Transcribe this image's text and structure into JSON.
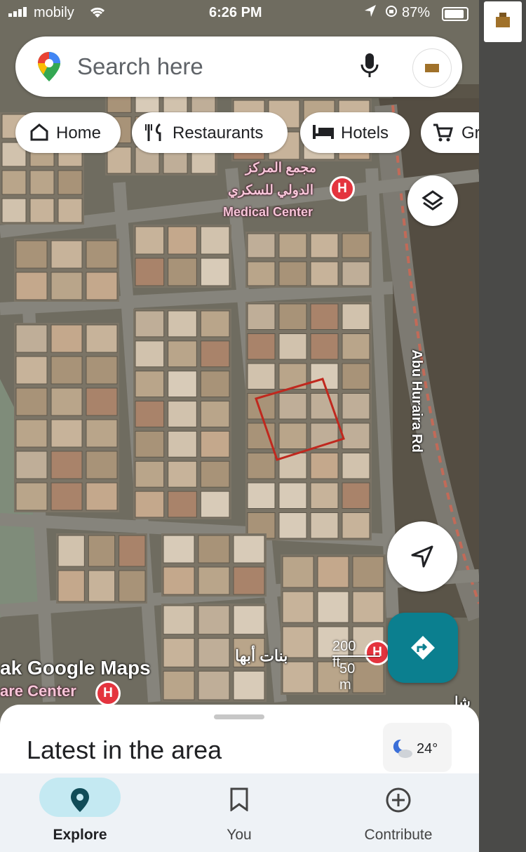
{
  "status": {
    "carrier": "mobily",
    "time": "6:26 PM",
    "battery": "87%"
  },
  "search": {
    "placeholder": "Search here"
  },
  "chips": [
    {
      "label": "Home",
      "icon": "home-icon"
    },
    {
      "label": "Restaurants",
      "icon": "restaurant-icon"
    },
    {
      "label": "Hotels",
      "icon": "hotel-icon"
    },
    {
      "label": "Gr",
      "icon": "cart-icon"
    }
  ],
  "map": {
    "labels": {
      "medical_ar_1": "مجمع المركز",
      "medical_ar_2": "الدولي للسكري",
      "medical_en": "Medical Center",
      "road": "Abu Huraira Rd",
      "place_ar": "بنات أبها",
      "left_top": "ak Google Maps",
      "left_bottom": "are Center",
      "corner_ar": "شا"
    },
    "scale": {
      "top": "200 ft",
      "bottom": "50 m"
    },
    "colors": {
      "highlight": "#c0281e",
      "marker": "#e4343e"
    }
  },
  "sheet": {
    "title": "Latest in the area",
    "weather": "24°"
  },
  "nav": [
    {
      "label": "Explore",
      "icon": "location-pin-icon",
      "active": true
    },
    {
      "label": "You",
      "icon": "bookmark-icon",
      "active": false
    },
    {
      "label": "Contribute",
      "icon": "add-circle-icon",
      "active": false
    }
  ],
  "colors": {
    "accent": "#0b7f8f",
    "active_pill": "#c4e9f2"
  }
}
